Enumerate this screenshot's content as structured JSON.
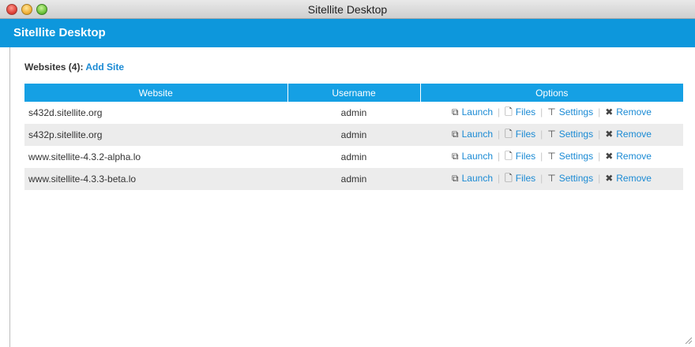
{
  "window": {
    "title": "Sitellite Desktop"
  },
  "app": {
    "title": "Sitellite Desktop"
  },
  "sites": {
    "label": "Websites (4):",
    "add_link": "Add Site"
  },
  "table": {
    "columns": [
      "Website",
      "Username",
      "Options"
    ],
    "rows": [
      {
        "website": "s432d.sitellite.org",
        "username": "admin"
      },
      {
        "website": "s432p.sitellite.org",
        "username": "admin"
      },
      {
        "website": "www.sitellite-4.3.2-alpha.lo",
        "username": "admin"
      },
      {
        "website": "www.sitellite-4.3.3-beta.lo",
        "username": "admin"
      }
    ],
    "options": {
      "launch": "Launch",
      "files": "Files",
      "settings": "Settings",
      "remove": "Remove"
    }
  },
  "colors": {
    "header_bg": "#0d97dc",
    "table_header_bg": "#15a0e4",
    "link": "#1a8ad4",
    "row_alt": "#ececec"
  },
  "icons": {
    "launch": "external-link-icon",
    "files": "file-icon",
    "settings": "pin-icon",
    "remove": "close-x-icon"
  }
}
